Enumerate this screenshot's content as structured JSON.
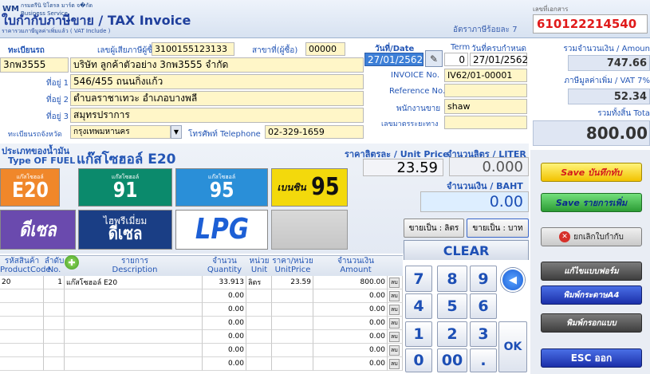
{
  "header": {
    "logo_text": "กรมตรีนิ ปิโตรล มาร์ต จ�กัด",
    "logo_sub": "Business Service",
    "title": "ใบกำกับภาษีขาย / TAX Invoice",
    "subtitle": "ราคารวมภาษีมูลค่าเพิ่มแล้ว ( VAT Include )",
    "vat_rate_label": "อัตราภาษีร้อยละ 7",
    "doc_no_label": "เลขที่เอกสาร",
    "doc_no": "610122214540"
  },
  "customer": {
    "reg_label": "ทะเบียนรถ",
    "reg_value": "3กพ3555",
    "taxid_label": "เลขผู้เสียภาษีผู้ซื้อ",
    "taxid_value": "3100155123133",
    "branch_label": "สาขาที่(ผู้ซื้อ)",
    "branch_value": "00000",
    "name_value": "บริษัท ลูกค้าตัวอย่าง 3กพ3555 จำกัด",
    "addr1_label": "ที่อยู่ 1",
    "addr1_value": "546/455 ถนนกิ่งแก้ว",
    "addr2_label": "ที่อยู่ 2",
    "addr2_value": "ตำบลราชาเทวะ  อำเภอบางพลี",
    "addr3_label": "ที่อยู่ 3",
    "addr3_value": "สมุทรปราการ",
    "province_label": "ทะเบียนรถจังหวัด",
    "province_value": "กรุงเทพมหานคร",
    "phone_label": "โทรศัพท์ Telephone",
    "phone_value": "02-329-1659"
  },
  "invoice": {
    "date_label": "วันที่/Date",
    "date_value": "27/01/2562",
    "term_label": "Term",
    "term_value": "0",
    "due_label": "วันที่ครบกำหนด",
    "due_value": "27/01/2562",
    "invno_label": "INVOICE No.",
    "invno_value": "IV62/01-00001",
    "ref_label": "Reference No.",
    "ref_value": "",
    "staff_label": "พนักงานขาย",
    "staff_value": "shaw",
    "mileage_label": "เลขมาตรระยะทาง",
    "mileage_value": ""
  },
  "summary": {
    "amount_label": "รวมจำนวนเงิน / Amoun",
    "amount_value": "747.66",
    "vat_label": "ภาษีมูลค่าเพิ่ม / VAT  7%",
    "vat_value": "52.34",
    "total_label": "รวมทั้งสิ้น Tota",
    "total_value": "800.00"
  },
  "fuel": {
    "type_label_th": "ประเภทของน้ำมัน",
    "type_label_en": "Type OF FUEL",
    "selected_name": "แก๊สโซฮอล์ E20",
    "price_label": "ราคาลิตรละ / Unit Price",
    "price_value": "23.59",
    "liter_label": "จำนวนลิตร / LITER",
    "liter_value": "0.000",
    "baht_label": "จำนวนเงิน / BAHT",
    "baht_value": "0.00",
    "sell_liter": "ขายเป็น : ลิตร",
    "sell_baht": "ขายเป็น : บาท",
    "clear": "CLEAR",
    "buttons": [
      {
        "small": "แก๊สโซฮอล์",
        "big": "E20"
      },
      {
        "small": "แก๊สโซฮอล์",
        "big": "91"
      },
      {
        "small": "แก๊สโซฮอล์",
        "big": "95"
      },
      {
        "small": "เบนซิน",
        "big": "95"
      },
      {
        "big": "ดีเซล"
      },
      {
        "small": "ไฮพรีเมี่ยม",
        "big": "ดีเซล"
      },
      {
        "big": "LPG"
      }
    ]
  },
  "table": {
    "headers": {
      "code_th": "รหัสสินค้า",
      "code_en": "ProductCode",
      "no_th": "ลำดับ",
      "no_en": "No.",
      "desc_th": "รายการ",
      "desc_en": "Description",
      "qty_th": "จำนวน",
      "qty_en": "Quantity",
      "unit_th": "หน่วย",
      "unit_en": "Unit",
      "price_th": "ราคา/หน่วย",
      "price_en": "UnitPrice",
      "amt_th": "จำนวนเงิน",
      "amt_en": "Amount"
    },
    "row_label": "ลบ",
    "rows": [
      {
        "code": "20",
        "no": "1",
        "desc": "แก๊สโซฮอล์ E20",
        "qty": "33.913",
        "unit": "ลิตร",
        "price": "23.59",
        "amt": "800.00"
      },
      {
        "code": "",
        "no": "",
        "desc": "",
        "qty": "0.00",
        "unit": "",
        "price": "",
        "amt": "0.00"
      },
      {
        "code": "",
        "no": "",
        "desc": "",
        "qty": "0.00",
        "unit": "",
        "price": "",
        "amt": "0.00"
      },
      {
        "code": "",
        "no": "",
        "desc": "",
        "qty": "0.00",
        "unit": "",
        "price": "",
        "amt": "0.00"
      },
      {
        "code": "",
        "no": "",
        "desc": "",
        "qty": "0.00",
        "unit": "",
        "price": "",
        "amt": "0.00"
      },
      {
        "code": "",
        "no": "",
        "desc": "",
        "qty": "0.00",
        "unit": "",
        "price": "",
        "amt": "0.00"
      },
      {
        "code": "",
        "no": "",
        "desc": "",
        "qty": "0.00",
        "unit": "",
        "price": "",
        "amt": "0.00"
      }
    ]
  },
  "keypad": {
    "k7": "7",
    "k8": "8",
    "k9": "9",
    "k4": "4",
    "k5": "5",
    "k6": "6",
    "k1": "1",
    "k2": "2",
    "k3": "3",
    "k0": "0",
    "k00": "00",
    "kdot": ".",
    "kok": "OK"
  },
  "actions": {
    "save": "Save บันทึกทับ",
    "save_add": "Save รายการเพิ่ม",
    "cancel": "ยกเลิกใบกำกับ",
    "edit_form": "แก้ไขแบบฟอร์ม",
    "print_a4": "พิมพ์กระดาษA4",
    "print_form": "พิมพ์กรอกแบบ",
    "esc": "ESC ออก"
  }
}
